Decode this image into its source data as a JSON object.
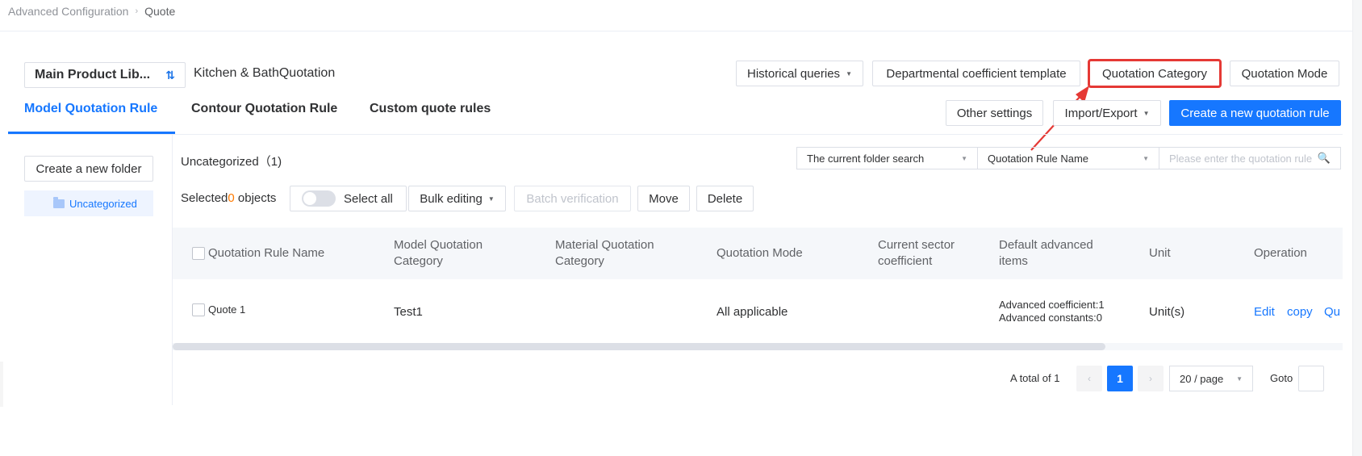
{
  "breadcrumb": {
    "root": "Advanced Configuration",
    "separator": "›",
    "current": "Quote"
  },
  "library": {
    "selector_label": "Main Product Lib...",
    "swap_icon": "⇅",
    "name": "Kitchen & BathQuotation"
  },
  "toolbar": {
    "historical_queries": "Historical queries",
    "coefficient_template": "Departmental coefficient template",
    "quotation_category": "Quotation Category",
    "quotation_mode": "Quotation Mode",
    "other_settings": "Other settings",
    "import_export": "Import/Export",
    "create_rule": "Create a new quotation rule",
    "caret": "▼"
  },
  "tabs": [
    {
      "label": "Model Quotation Rule"
    },
    {
      "label": "Contour Quotation Rule"
    },
    {
      "label": "Custom quote rules"
    }
  ],
  "sidebar": {
    "new_folder": "Create a new folder",
    "folder": "Uncategorized"
  },
  "content": {
    "category_title": "Uncategorized（1)",
    "search_scope": "The current folder search",
    "search_field": "Quotation Rule Name",
    "search_placeholder": "Please enter the quotation rule",
    "search_icon": "🔍",
    "selected_prefix": "Selected",
    "selected_count": "0",
    "selected_suffix": " objects",
    "select_all": "Select all",
    "bulk_editing": "Bulk editing",
    "batch_verification": "Batch verification",
    "move": "Move",
    "delete": "Delete"
  },
  "table": {
    "columns": {
      "name": "Quotation Rule Name",
      "model_category_1": "Model Quotation",
      "model_category_2": "Category",
      "material_category_1": "Material Quotation",
      "material_category_2": "Category",
      "mode": "Quotation Mode",
      "sector_1": "Current sector",
      "sector_2": "coefficient",
      "advanced_1": "Default advanced",
      "advanced_2": "items",
      "unit": "Unit",
      "operation": "Operation"
    },
    "rows": [
      {
        "name": "Quote 1",
        "model_category": "Test1",
        "material_category": "",
        "mode": "All applicable",
        "sector": "",
        "advanced_coefficient": "Advanced coefficient:1",
        "advanced_constants": "Advanced constants:0",
        "unit": "Unit(s)",
        "op_edit": "Edit",
        "op_copy": "copy",
        "op_more": "Qu"
      }
    ]
  },
  "pagination": {
    "total": "A total of 1",
    "prev": "‹",
    "page": "1",
    "next": "›",
    "page_size": "20 / page",
    "goto": "Goto"
  },
  "colors": {
    "accent": "#1677ff",
    "highlight": "#e53935",
    "count": "#ff7a00"
  }
}
